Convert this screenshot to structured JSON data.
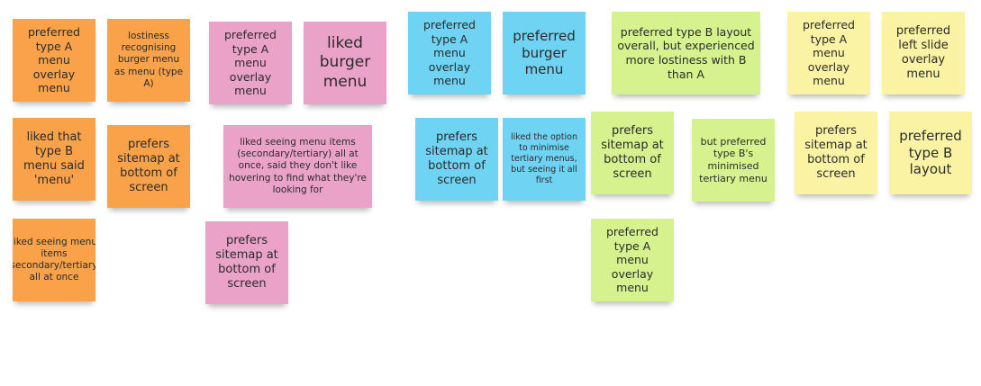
{
  "notes": [
    {
      "id": "o1",
      "color": "orange",
      "text": "preferred type A menu overlay menu"
    },
    {
      "id": "o2",
      "color": "orange",
      "text": "lostiness recognising burger menu as menu (type A)"
    },
    {
      "id": "o3",
      "color": "orange",
      "text": "liked that type B menu said 'menu'"
    },
    {
      "id": "o4",
      "color": "orange",
      "text": "prefers sitemap at bottom of screen"
    },
    {
      "id": "o5",
      "color": "orange",
      "text": "liked seeing menu items (secondary/tertiary) all at once"
    },
    {
      "id": "p1",
      "color": "pink",
      "text": "preferred type A menu overlay menu"
    },
    {
      "id": "p2",
      "color": "pink",
      "text": "liked burger menu"
    },
    {
      "id": "p3",
      "color": "pink",
      "text": "liked seeing menu items (secondary/tertiary) all at once, said they don't like hovering to find what they're looking for"
    },
    {
      "id": "p4",
      "color": "pink",
      "text": "prefers sitemap at bottom of screen"
    },
    {
      "id": "b1",
      "color": "blue",
      "text": "preferred type A menu overlay menu"
    },
    {
      "id": "b2",
      "color": "blue",
      "text": "preferred burger menu"
    },
    {
      "id": "b3",
      "color": "blue",
      "text": "prefers sitemap at bottom of screen"
    },
    {
      "id": "b4",
      "color": "blue",
      "text": "liked the option to minimise tertiary menus, but seeing it all first"
    },
    {
      "id": "g1",
      "color": "green",
      "text": "preferred type B layout overall, but experienced more lostiness with B than A"
    },
    {
      "id": "g2",
      "color": "green",
      "text": "prefers sitemap at bottom of screen"
    },
    {
      "id": "g3",
      "color": "green",
      "text": "but preferred type B's minimised tertiary menu"
    },
    {
      "id": "g4",
      "color": "green",
      "text": "preferred type A menu overlay menu"
    },
    {
      "id": "y1",
      "color": "yellow",
      "text": "preferred type A menu overlay menu"
    },
    {
      "id": "y2",
      "color": "yellow",
      "text": "preferred left slide overlay menu"
    },
    {
      "id": "y3",
      "color": "yellow",
      "text": "prefers sitemap at bottom of screen"
    },
    {
      "id": "y4",
      "color": "yellow",
      "text": "preferred type B layout"
    }
  ]
}
